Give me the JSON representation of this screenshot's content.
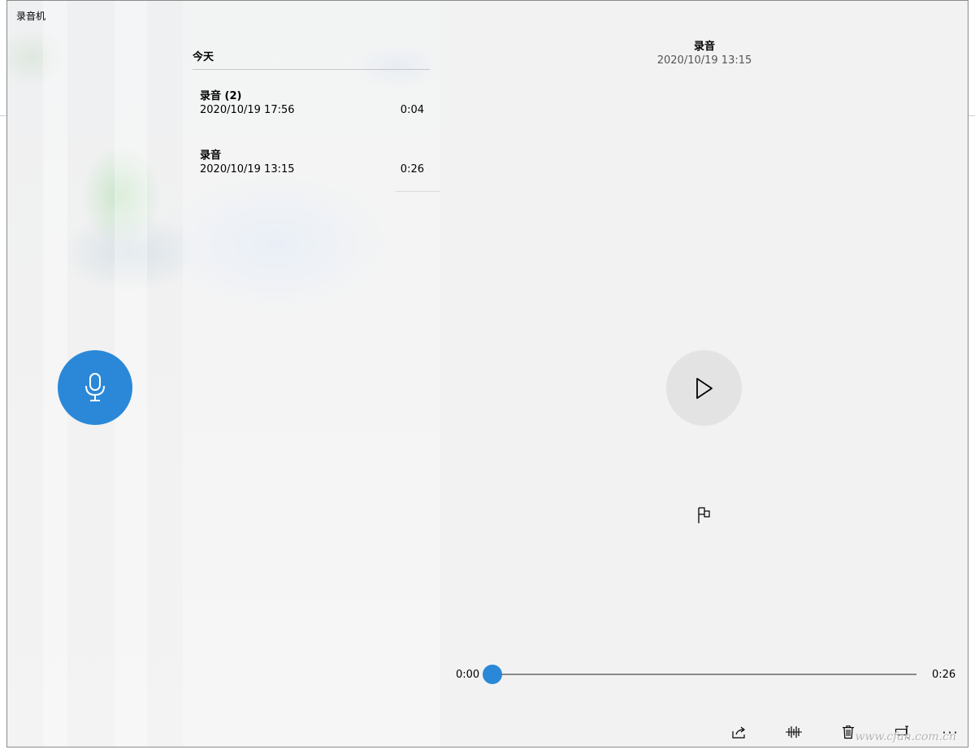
{
  "window": {
    "title": "录音机",
    "controls": {
      "minimize": "minimize-icon",
      "maximize": "maximize-icon",
      "close": "close-icon"
    }
  },
  "record": {
    "icon": "microphone-icon",
    "color": "#2b88d8"
  },
  "list": {
    "group_header": "今天",
    "items": [
      {
        "name": "录音 (2)",
        "date": "2020/10/19 17:56",
        "duration": "0:04"
      },
      {
        "name": "录音",
        "date": "2020/10/19 13:15",
        "duration": "0:26"
      }
    ]
  },
  "player": {
    "title": "录音",
    "date": "2020/10/19 13:15",
    "play_icon": "play-icon",
    "marker_icon": "flag-icon",
    "time_current": "0:00",
    "time_total": "0:26",
    "progress": 0,
    "toolbar": [
      {
        "id": "share",
        "icon": "share-icon"
      },
      {
        "id": "trim",
        "icon": "trim-icon"
      },
      {
        "id": "delete",
        "icon": "trash-icon"
      },
      {
        "id": "rename",
        "icon": "rename-icon"
      },
      {
        "id": "more",
        "icon": "more-icon",
        "label": "···"
      }
    ]
  },
  "watermark": "www.cfan.com.cn"
}
